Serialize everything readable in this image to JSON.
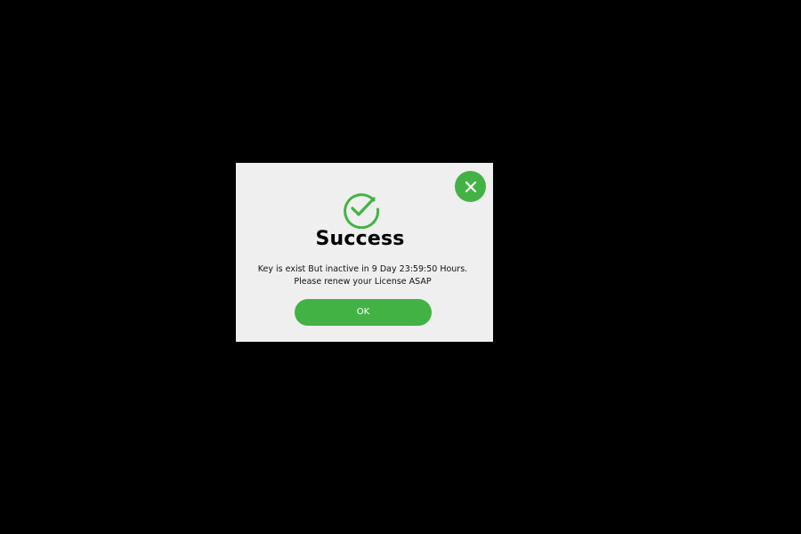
{
  "dialog": {
    "title": "Success",
    "message_line_1": "Key is exist But inactive in 9 Day 23:59:50 Hours.",
    "message_line_2": "Please renew your License ASAP",
    "ok_label": "OK",
    "icons": {
      "status": "check-circle-icon",
      "close": "close-icon"
    }
  },
  "colors": {
    "accent": "#43b244",
    "dialog_background": "#efefef",
    "page_background": "#000000"
  }
}
